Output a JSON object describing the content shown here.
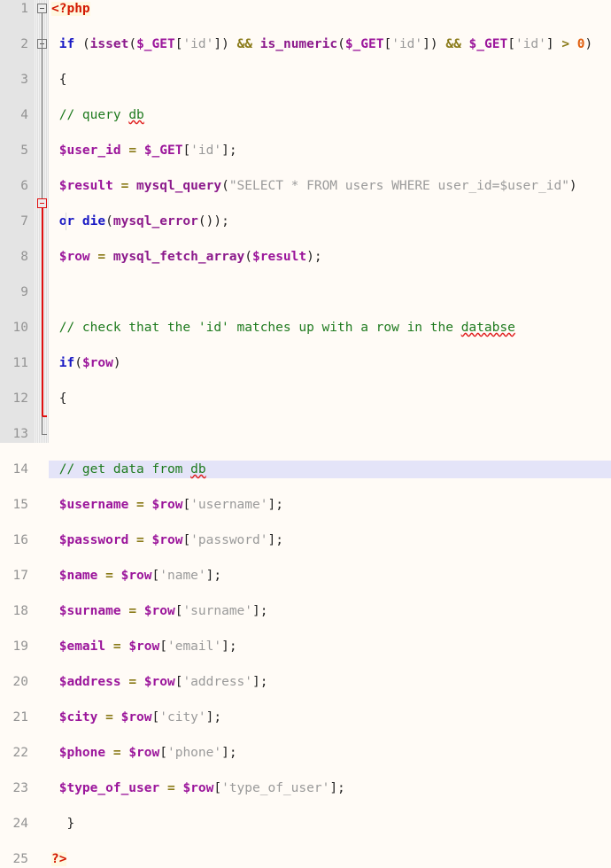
{
  "editor": {
    "language": "PHP",
    "filename": "",
    "colors": {
      "background": "#FFFBF6",
      "gutter_background": "#E4E4E4",
      "gutter_text": "#939393",
      "current_line_highlight": "#E4E4F8",
      "php_tag": "#D31800",
      "keyword": "#1919C4",
      "function": "#8C1A8C",
      "variable": "#9B159B",
      "string": "#9A9A9A",
      "comment": "#1E7A1E",
      "operator": "#8A7A18",
      "number": "#E06010",
      "punctuation": "#242424",
      "fold_marker_active": "#E01010",
      "fold_marker": "#777777",
      "spellcheck_underline": "#E02020"
    },
    "current_line": 14,
    "first_line": 1,
    "last_line": 25,
    "total_lines": 25
  },
  "lines": [
    {
      "number": "1",
      "fold": "open",
      "tokens": [
        {
          "text": "<?php",
          "cls": "t-tag"
        }
      ]
    },
    {
      "number": "2",
      "fold": "none",
      "tokens": [
        {
          "text": " ",
          "cls": "t-plain"
        },
        {
          "text": "if",
          "cls": "t-kw"
        },
        {
          "text": " ",
          "cls": "t-plain"
        },
        {
          "text": "(",
          "cls": "t-pun"
        },
        {
          "text": "isset",
          "cls": "t-fn"
        },
        {
          "text": "(",
          "cls": "t-pun"
        },
        {
          "text": "$_GET",
          "cls": "t-var"
        },
        {
          "text": "[",
          "cls": "t-pun"
        },
        {
          "text": "'id'",
          "cls": "t-str"
        },
        {
          "text": "])",
          "cls": "t-pun"
        },
        {
          "text": " ",
          "cls": "t-plain"
        },
        {
          "text": "&&",
          "cls": "t-op"
        },
        {
          "text": " ",
          "cls": "t-plain"
        },
        {
          "text": "is_numeric",
          "cls": "t-fn"
        },
        {
          "text": "(",
          "cls": "t-pun"
        },
        {
          "text": "$_GET",
          "cls": "t-var"
        },
        {
          "text": "[",
          "cls": "t-pun"
        },
        {
          "text": "'id'",
          "cls": "t-str"
        },
        {
          "text": "])",
          "cls": "t-pun"
        },
        {
          "text": " ",
          "cls": "t-plain"
        },
        {
          "text": "&&",
          "cls": "t-op"
        },
        {
          "text": " ",
          "cls": "t-plain"
        },
        {
          "text": "$_GET",
          "cls": "t-var"
        },
        {
          "text": "[",
          "cls": "t-pun"
        },
        {
          "text": "'id'",
          "cls": "t-str"
        },
        {
          "text": "]",
          "cls": "t-pun"
        },
        {
          "text": " ",
          "cls": "t-plain"
        },
        {
          "text": ">",
          "cls": "t-op"
        },
        {
          "text": " ",
          "cls": "t-plain"
        },
        {
          "text": "0",
          "cls": "t-num"
        },
        {
          "text": ")",
          "cls": "t-pun"
        }
      ]
    },
    {
      "number": "3",
      "fold": "open",
      "tokens": [
        {
          "text": " {",
          "cls": "t-pun"
        }
      ]
    },
    {
      "number": "4",
      "fold": "none",
      "tokens": [
        {
          "text": " // query ",
          "cls": "t-com"
        },
        {
          "text": "db",
          "cls": "t-com sp"
        }
      ]
    },
    {
      "number": "5",
      "fold": "none",
      "tokens": [
        {
          "text": " ",
          "cls": "t-plain"
        },
        {
          "text": "$user_id",
          "cls": "t-var"
        },
        {
          "text": " ",
          "cls": "t-plain"
        },
        {
          "text": "=",
          "cls": "t-op"
        },
        {
          "text": " ",
          "cls": "t-plain"
        },
        {
          "text": "$_GET",
          "cls": "t-var"
        },
        {
          "text": "[",
          "cls": "t-pun"
        },
        {
          "text": "'id'",
          "cls": "t-str"
        },
        {
          "text": "];",
          "cls": "t-pun"
        }
      ]
    },
    {
      "number": "6",
      "fold": "none",
      "tokens": [
        {
          "text": " ",
          "cls": "t-plain"
        },
        {
          "text": "$result",
          "cls": "t-var"
        },
        {
          "text": " ",
          "cls": "t-plain"
        },
        {
          "text": "=",
          "cls": "t-op"
        },
        {
          "text": " ",
          "cls": "t-plain"
        },
        {
          "text": "mysql_query",
          "cls": "t-fn"
        },
        {
          "text": "(",
          "cls": "t-pun"
        },
        {
          "text": "\"SELECT * FROM users WHERE user_id=$user_id\"",
          "cls": "t-str"
        },
        {
          "text": ")",
          "cls": "t-pun"
        }
      ]
    },
    {
      "number": "7",
      "fold": "none",
      "tokens": [
        {
          "text": " ",
          "cls": "t-plain"
        },
        {
          "text": "or die",
          "cls": "t-kw"
        },
        {
          "text": "(",
          "cls": "t-pun"
        },
        {
          "text": "mysql_error",
          "cls": "t-fn"
        },
        {
          "text": "());",
          "cls": "t-pun"
        }
      ]
    },
    {
      "number": "8",
      "fold": "none",
      "tokens": [
        {
          "text": " ",
          "cls": "t-plain"
        },
        {
          "text": "$row",
          "cls": "t-var"
        },
        {
          "text": " ",
          "cls": "t-plain"
        },
        {
          "text": "=",
          "cls": "t-op"
        },
        {
          "text": " ",
          "cls": "t-plain"
        },
        {
          "text": "mysql_fetch_array",
          "cls": "t-fn"
        },
        {
          "text": "(",
          "cls": "t-pun"
        },
        {
          "text": "$result",
          "cls": "t-var"
        },
        {
          "text": ");",
          "cls": "t-pun"
        }
      ]
    },
    {
      "number": "9",
      "fold": "none",
      "tokens": []
    },
    {
      "number": "10",
      "fold": "none",
      "tokens": [
        {
          "text": " // check that the 'id' matches up with a row in the ",
          "cls": "t-com"
        },
        {
          "text": "databse",
          "cls": "t-com sp"
        }
      ]
    },
    {
      "number": "11",
      "fold": "none",
      "tokens": [
        {
          "text": " ",
          "cls": "t-plain"
        },
        {
          "text": "if",
          "cls": "t-kw"
        },
        {
          "text": "(",
          "cls": "t-pun"
        },
        {
          "text": "$row",
          "cls": "t-var"
        },
        {
          "text": ")",
          "cls": "t-pun"
        }
      ]
    },
    {
      "number": "12",
      "fold": "open-active",
      "tokens": [
        {
          "text": " {",
          "cls": "t-pun"
        }
      ]
    },
    {
      "number": "13",
      "fold": "none",
      "tokens": []
    },
    {
      "number": "14",
      "fold": "none",
      "current": true,
      "tokens": [
        {
          "text": " // get data from ",
          "cls": "t-com"
        },
        {
          "text": "db",
          "cls": "t-com sp"
        }
      ]
    },
    {
      "number": "15",
      "fold": "none",
      "tokens": [
        {
          "text": " ",
          "cls": "t-plain"
        },
        {
          "text": "$username",
          "cls": "t-var"
        },
        {
          "text": " ",
          "cls": "t-plain"
        },
        {
          "text": "=",
          "cls": "t-op"
        },
        {
          "text": " ",
          "cls": "t-plain"
        },
        {
          "text": "$row",
          "cls": "t-var"
        },
        {
          "text": "[",
          "cls": "t-pun"
        },
        {
          "text": "'username'",
          "cls": "t-str"
        },
        {
          "text": "];",
          "cls": "t-pun"
        }
      ]
    },
    {
      "number": "16",
      "fold": "none",
      "tokens": [
        {
          "text": " ",
          "cls": "t-plain"
        },
        {
          "text": "$password",
          "cls": "t-var"
        },
        {
          "text": " ",
          "cls": "t-plain"
        },
        {
          "text": "=",
          "cls": "t-op"
        },
        {
          "text": " ",
          "cls": "t-plain"
        },
        {
          "text": "$row",
          "cls": "t-var"
        },
        {
          "text": "[",
          "cls": "t-pun"
        },
        {
          "text": "'password'",
          "cls": "t-str"
        },
        {
          "text": "];",
          "cls": "t-pun"
        }
      ]
    },
    {
      "number": "17",
      "fold": "none",
      "tokens": [
        {
          "text": " ",
          "cls": "t-plain"
        },
        {
          "text": "$name",
          "cls": "t-var"
        },
        {
          "text": " ",
          "cls": "t-plain"
        },
        {
          "text": "=",
          "cls": "t-op"
        },
        {
          "text": " ",
          "cls": "t-plain"
        },
        {
          "text": "$row",
          "cls": "t-var"
        },
        {
          "text": "[",
          "cls": "t-pun"
        },
        {
          "text": "'name'",
          "cls": "t-str"
        },
        {
          "text": "];",
          "cls": "t-pun"
        }
      ]
    },
    {
      "number": "18",
      "fold": "none",
      "tokens": [
        {
          "text": " ",
          "cls": "t-plain"
        },
        {
          "text": "$surname",
          "cls": "t-var"
        },
        {
          "text": " ",
          "cls": "t-plain"
        },
        {
          "text": "=",
          "cls": "t-op"
        },
        {
          "text": " ",
          "cls": "t-plain"
        },
        {
          "text": "$row",
          "cls": "t-var"
        },
        {
          "text": "[",
          "cls": "t-pun"
        },
        {
          "text": "'surname'",
          "cls": "t-str"
        },
        {
          "text": "];",
          "cls": "t-pun"
        }
      ]
    },
    {
      "number": "19",
      "fold": "none",
      "tokens": [
        {
          "text": " ",
          "cls": "t-plain"
        },
        {
          "text": "$email",
          "cls": "t-var"
        },
        {
          "text": " ",
          "cls": "t-plain"
        },
        {
          "text": "=",
          "cls": "t-op"
        },
        {
          "text": " ",
          "cls": "t-plain"
        },
        {
          "text": "$row",
          "cls": "t-var"
        },
        {
          "text": "[",
          "cls": "t-pun"
        },
        {
          "text": "'email'",
          "cls": "t-str"
        },
        {
          "text": "];",
          "cls": "t-pun"
        }
      ]
    },
    {
      "number": "20",
      "fold": "none",
      "tokens": [
        {
          "text": " ",
          "cls": "t-plain"
        },
        {
          "text": "$address",
          "cls": "t-var"
        },
        {
          "text": " ",
          "cls": "t-plain"
        },
        {
          "text": "=",
          "cls": "t-op"
        },
        {
          "text": " ",
          "cls": "t-plain"
        },
        {
          "text": "$row",
          "cls": "t-var"
        },
        {
          "text": "[",
          "cls": "t-pun"
        },
        {
          "text": "'address'",
          "cls": "t-str"
        },
        {
          "text": "];",
          "cls": "t-pun"
        }
      ]
    },
    {
      "number": "21",
      "fold": "none",
      "tokens": [
        {
          "text": " ",
          "cls": "t-plain"
        },
        {
          "text": "$city",
          "cls": "t-var"
        },
        {
          "text": " ",
          "cls": "t-plain"
        },
        {
          "text": "=",
          "cls": "t-op"
        },
        {
          "text": " ",
          "cls": "t-plain"
        },
        {
          "text": "$row",
          "cls": "t-var"
        },
        {
          "text": "[",
          "cls": "t-pun"
        },
        {
          "text": "'city'",
          "cls": "t-str"
        },
        {
          "text": "];",
          "cls": "t-pun"
        }
      ]
    },
    {
      "number": "22",
      "fold": "none",
      "tokens": [
        {
          "text": " ",
          "cls": "t-plain"
        },
        {
          "text": "$phone",
          "cls": "t-var"
        },
        {
          "text": " ",
          "cls": "t-plain"
        },
        {
          "text": "=",
          "cls": "t-op"
        },
        {
          "text": " ",
          "cls": "t-plain"
        },
        {
          "text": "$row",
          "cls": "t-var"
        },
        {
          "text": "[",
          "cls": "t-pun"
        },
        {
          "text": "'phone'",
          "cls": "t-str"
        },
        {
          "text": "];",
          "cls": "t-pun"
        }
      ]
    },
    {
      "number": "23",
      "fold": "none",
      "tokens": [
        {
          "text": " ",
          "cls": "t-plain"
        },
        {
          "text": "$type_of_user",
          "cls": "t-var"
        },
        {
          "text": " ",
          "cls": "t-plain"
        },
        {
          "text": "=",
          "cls": "t-op"
        },
        {
          "text": " ",
          "cls": "t-plain"
        },
        {
          "text": "$row",
          "cls": "t-var"
        },
        {
          "text": "[",
          "cls": "t-pun"
        },
        {
          "text": "'type_of_user'",
          "cls": "t-str"
        },
        {
          "text": "];",
          "cls": "t-pun"
        }
      ]
    },
    {
      "number": "24",
      "fold": "none",
      "tokens": [
        {
          "text": "  }",
          "cls": "t-pun"
        }
      ]
    },
    {
      "number": "25",
      "fold": "end",
      "tokens": [
        {
          "text": "?>",
          "cls": "t-tag"
        }
      ]
    }
  ]
}
